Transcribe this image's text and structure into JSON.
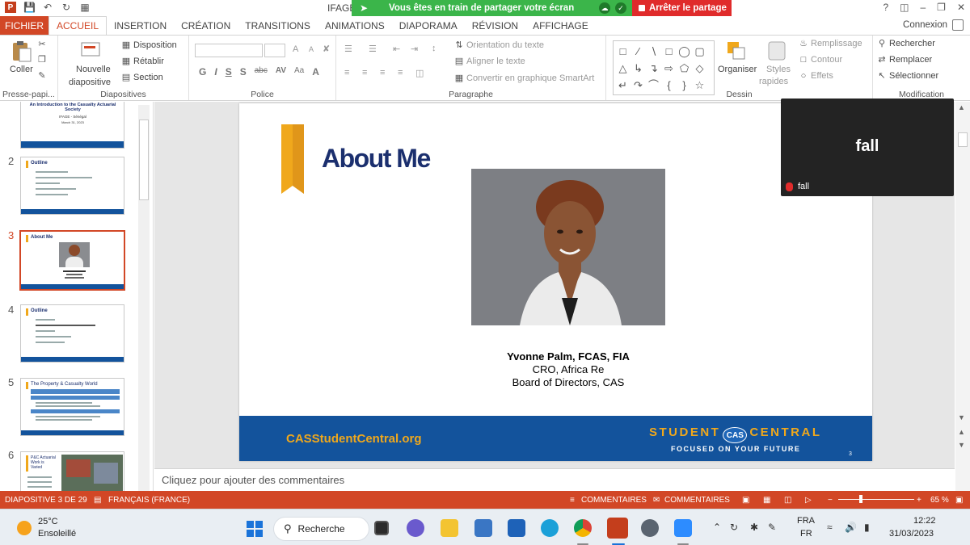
{
  "titlebar": {
    "doc_title": "IFAGE",
    "share_text": "Vous êtes en train de partager votre écran",
    "stop_share": "Arrêter le partage",
    "help": "?",
    "minimize": "–"
  },
  "tabs": [
    "FICHIER",
    "ACCUEIL",
    "INSERTION",
    "CRÉATION",
    "TRANSITIONS",
    "ANIMATIONS",
    "DIAPORAMA",
    "RÉVISION",
    "AFFICHAGE"
  ],
  "signin": "Connexion",
  "ribbon": {
    "clipboard": {
      "paste": "Coller",
      "label": "Presse-papi..."
    },
    "slides": {
      "new_slide_1": "Nouvelle",
      "new_slide_2": "diapositive",
      "layout": "Disposition",
      "reset": "Rétablir",
      "section": "Section",
      "label": "Diapositives"
    },
    "font": {
      "label": "Police",
      "bold": "G",
      "italic": "I",
      "underline": "S",
      "shadow": "S",
      "strike": "abc",
      "spacing": "AV",
      "case": "Aa",
      "grow": "A",
      "shrink": "A",
      "color": "A"
    },
    "paragraph": {
      "orientation": "Orientation du texte",
      "align": "Aligner le texte",
      "smartart": "Convertir en graphique SmartArt",
      "label": "Paragraphe"
    },
    "drawing": {
      "arrange": "Organiser",
      "styles_1": "Styles",
      "styles_2": "rapides",
      "fill": "Remplissage",
      "outline": "Contour",
      "effects": "Effets",
      "label": "Dessin"
    },
    "editing": {
      "find": "Rechercher",
      "replace": "Remplacer",
      "select": "Sélectionner",
      "label": "Modification"
    }
  },
  "thumbnails": [
    {
      "num": "",
      "title": "An Introduction to the Casualty Actuarial Society",
      "sub": "IFAGE - Sénégal",
      "date": "March 31, 2023"
    },
    {
      "num": "2",
      "title": "Outline"
    },
    {
      "num": "3",
      "title": "About Me"
    },
    {
      "num": "4",
      "title": "Outline"
    },
    {
      "num": "5",
      "title": "The Property & Casualty World"
    },
    {
      "num": "6",
      "title": "P&C Actuarial Work is Varied"
    }
  ],
  "slide": {
    "title": "About Me",
    "name": "Yvonne Palm, FCAS, FIA",
    "role1": "CRO, Africa Re",
    "role2": "Board of Directors, CAS",
    "footer_url": "CASStudentCentral.org",
    "brand_left": "STUDENT",
    "brand_logo": "CAS",
    "brand_right": "CENTRAL",
    "tagline": "FOCUSED ON YOUR FUTURE",
    "page": "3"
  },
  "notes_placeholder": "Cliquez pour ajouter des commentaires",
  "video": {
    "display_name": "fall",
    "label": "fall"
  },
  "status": {
    "slide_info": "DIAPOSITIVE 3 DE 29",
    "language": "FRANÇAIS (FRANCE)",
    "notes": "COMMENTAIRES",
    "comments": "COMMENTAIRES",
    "zoom": "65 %"
  },
  "taskbar": {
    "temp": "25°C",
    "weather": "Ensoleillé",
    "search": "Recherche",
    "lang1": "FRA",
    "lang2": "FR",
    "time": "12:22",
    "date": "31/03/2023"
  },
  "colors": {
    "accent": "#d24726",
    "slide_blue": "#13539c",
    "slide_gold": "#f0a81c",
    "title_navy": "#1b2f6e",
    "share_green": "#3bb54a",
    "stop_red": "#e02b2b"
  }
}
